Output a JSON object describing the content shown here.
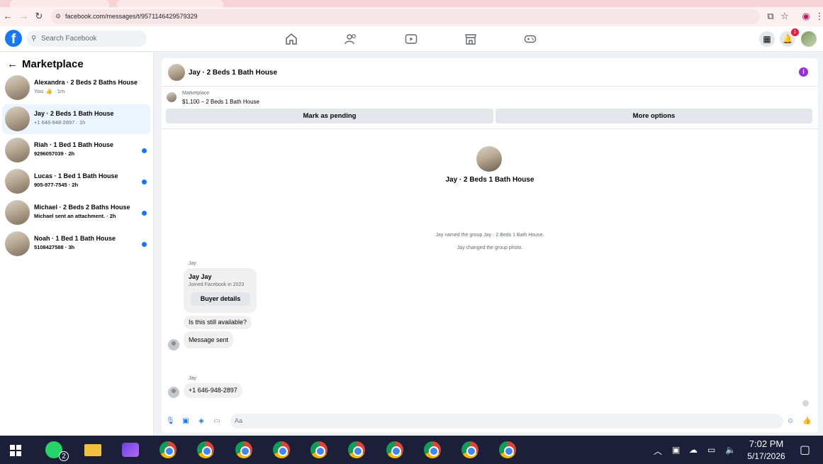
{
  "browser": {
    "url": "facebook.com/messages/t/9571146429579329"
  },
  "header": {
    "search_placeholder": "Search Facebook",
    "notification_count": "1"
  },
  "sidebar": {
    "title": "Marketplace",
    "conversations": [
      {
        "name": "Alexandra · 2 Beds 2 Baths House",
        "sub": "You: 👍 · 1m",
        "unread": false,
        "active": false
      },
      {
        "name": "Jay · 2 Beds 1 Bath House",
        "sub": "+1 646-948-2897 · 1h",
        "unread": false,
        "active": true
      },
      {
        "name": "Riah · 1 Bed 1 Bath House",
        "sub": "9296057039 · 2h",
        "unread": true,
        "active": false
      },
      {
        "name": "Lucas · 1 Bed 1 Bath House",
        "sub": "905-977-7545 · 2h",
        "unread": true,
        "active": false
      },
      {
        "name": "Michael · 2 Beds 2 Baths House",
        "sub": "Michael sent an attachment. · 2h",
        "unread": true,
        "active": false
      },
      {
        "name": "Noah · 1 Bed 1 Bath House",
        "sub": "5108427588 · 3h",
        "unread": true,
        "active": false
      }
    ]
  },
  "chat": {
    "title": "Jay · 2 Beds 1 Bath House",
    "listing_label": "Marketplace",
    "listing_detail": "$1,100 – 2 Beds 1 Bath House",
    "mark_pending": "Mark as pending",
    "more_options": "More options",
    "group_name": "Jay · 2 Beds 1 Bath House",
    "system_1": "Jay named the group Jay · 2 Beds 1 Bath House.",
    "system_2": "Jay changed the group photo.",
    "sender_1": "Jay",
    "profile_name": "Jay Jay",
    "profile_joined": "Joined Facebook in 2023",
    "buyer_details": "Buyer details",
    "msg_1": "Is this still available?",
    "msg_2": "Message sent",
    "sender_2": "Jay",
    "msg_3": "+1 646-948-2897",
    "composer_placeholder": "Aa"
  },
  "taskbar": {
    "whatsapp_badge": "2",
    "time": "7:02 PM",
    "date": "5/17/2026"
  },
  "colors": {
    "fb_blue": "#1877f2",
    "unread_dot": "#1877f2",
    "info_purple": "#9a2fd9",
    "taskbar": "#1b1f3a"
  }
}
